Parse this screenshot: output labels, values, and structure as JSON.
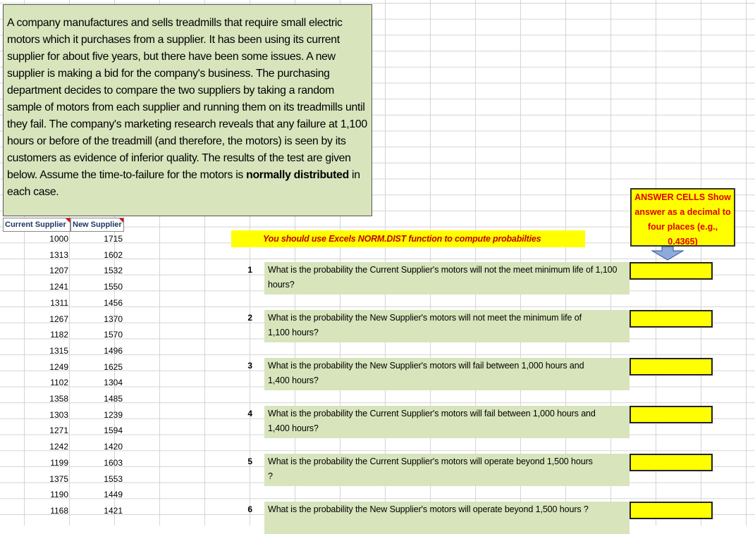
{
  "problem": {
    "text_before_bold": "A company manufactures and sells treadmills that require small electric motors which it purchases from a supplier.  It has been using its current supplier for about five years, but there have been some issues.  A new supplier is making a bid for the company's business.  The purchasing department decides to compare the two suppliers by taking a random sample of motors from each supplier and running them on its treadmills until they fail.  The company's marketing research reveals that any failure at 1,100 hours or before of the treadmill (and therefore, the motors) is seen by its customers as evidence of inferior quality.  The results of the test are given below.  Assume the time-to-failure for the motors is ",
    "bold_text": "normally distributed",
    "text_after_bold": " in each case."
  },
  "table": {
    "headers": [
      "Current Supplier",
      "New Supplier"
    ],
    "current": [
      "1000",
      "1313",
      "1207",
      "1241",
      "1311",
      "1267",
      "1182",
      "1315",
      "1249",
      "1102",
      "1358",
      "1303",
      "1271",
      "1242",
      "1199",
      "1375",
      "1190",
      "1168"
    ],
    "new": [
      "1715",
      "1602",
      "1532",
      "1550",
      "1456",
      "1370",
      "1570",
      "1496",
      "1625",
      "1304",
      "1485",
      "1239",
      "1594",
      "1420",
      "1603",
      "1553",
      "1449",
      "1421"
    ]
  },
  "norm_note": "You should use Excels NORM.DIST function to compute probabilties",
  "answer_note": [
    "ANSWER CELLS Show",
    "answer as a decimal to",
    "four places (e.g.,",
    "0.4365)"
  ],
  "questions": [
    {
      "num": "1",
      "line1": "What is the probability the Current Supplier's motors will not the meet minimum life of 1,100",
      "line2": "hours?"
    },
    {
      "num": "2",
      "line1": "What is the probability the New Supplier's motors will not meet the minimum life of",
      "line2": "1,100 hours?"
    },
    {
      "num": "3",
      "line1": "What is the probability the New Supplier's motors will fail between 1,000 hours and",
      "line2": "1,400 hours?"
    },
    {
      "num": "4",
      "line1": "What is the probability the Current Supplier's motors will fail between 1,000 hours and",
      "line2": "1,400 hours?"
    },
    {
      "num": "5",
      "line1": "What is the probability the Current Supplier's motors will operate beyond 1,500 hours",
      "line2": "?"
    },
    {
      "num": "6",
      "line1": "What is the probability the New Supplier's motors will operate beyond 1,500 hours ?",
      "line2": ""
    }
  ],
  "colors": {
    "green_fill": "#d8e4bc",
    "yellow_fill": "#ffff00",
    "red_text": "#e00000",
    "arrow": "#8eaadb"
  },
  "icons": {
    "answer_pointer": "down-arrow-icon"
  }
}
